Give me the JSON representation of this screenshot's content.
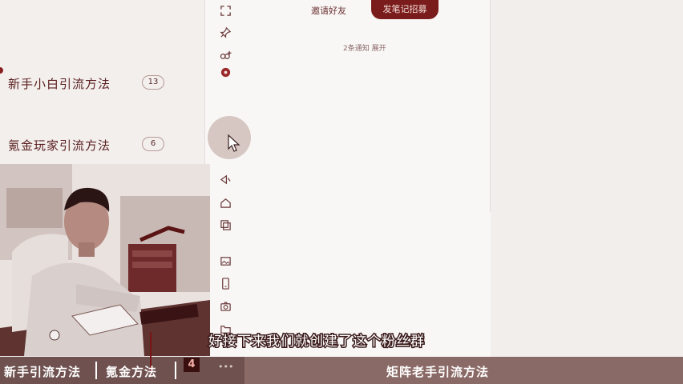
{
  "header": {
    "invite_label": "邀请好友",
    "post_button_label": "发笔记招募",
    "notice_text": "2条通知 展开"
  },
  "groups": [
    {
      "name": "新手小白引流方法",
      "count": "13"
    },
    {
      "name": "氪金玩家引流方法",
      "count": "6"
    }
  ],
  "toolbar": {
    "icons": [
      "fullscreen-icon",
      "pin-icon",
      "add-member-icon",
      "record-icon",
      "back-icon",
      "home-icon",
      "copy-icon",
      "image-icon",
      "phone-icon",
      "camera-icon",
      "folder-icon"
    ]
  },
  "subtitle": "好接下来我们就创建了这个粉丝群",
  "bottom_bar": {
    "tab1": "新手引流方法",
    "tab2": "氪金方法",
    "tab_number": "4",
    "more": "•••",
    "right_label": "矩阵老手引流方法"
  },
  "colors": {
    "accent": "#7a1c1c",
    "bottom_bar": "#8a6a66"
  }
}
